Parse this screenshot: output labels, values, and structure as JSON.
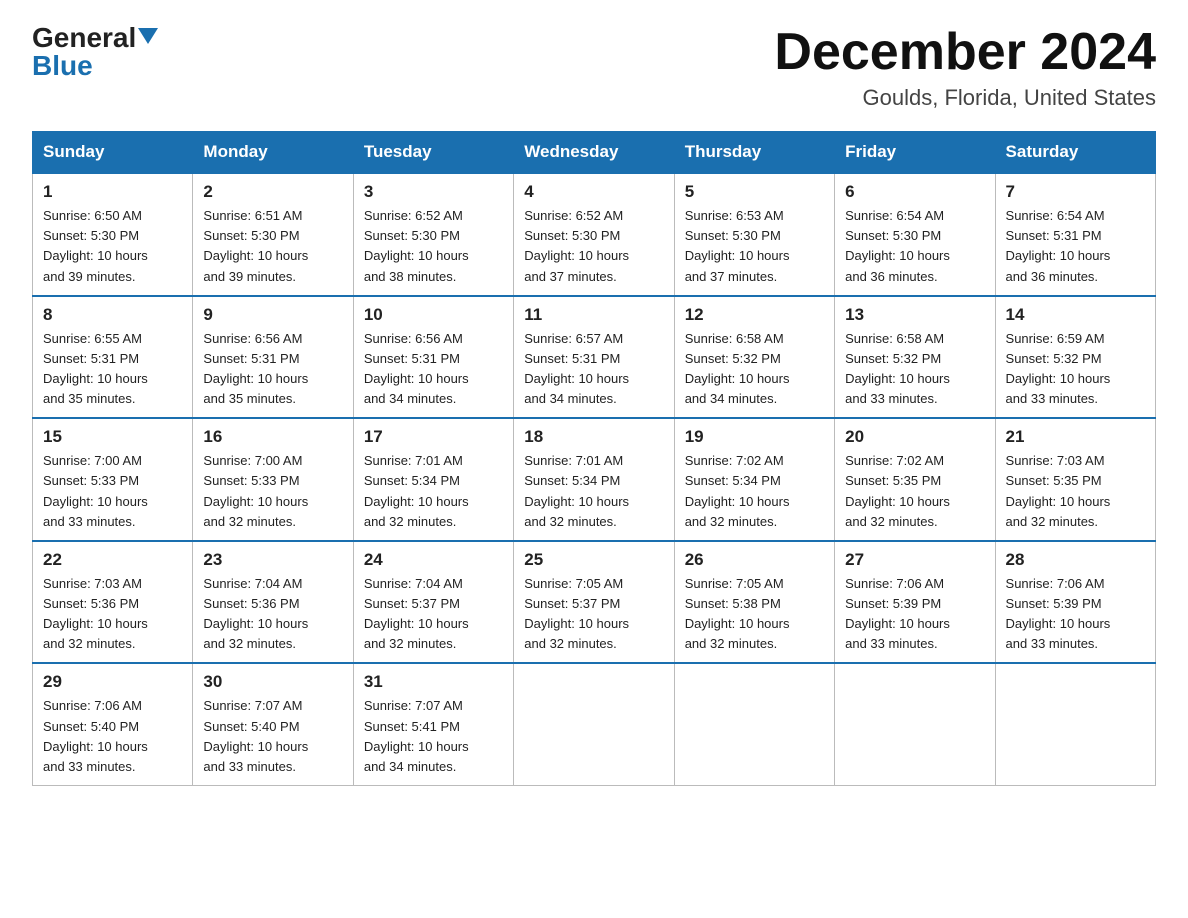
{
  "logo": {
    "general": "General",
    "blue": "Blue"
  },
  "header": {
    "month": "December 2024",
    "location": "Goulds, Florida, United States"
  },
  "weekdays": [
    "Sunday",
    "Monday",
    "Tuesday",
    "Wednesday",
    "Thursday",
    "Friday",
    "Saturday"
  ],
  "weeks": [
    [
      {
        "day": "1",
        "info": "Sunrise: 6:50 AM\nSunset: 5:30 PM\nDaylight: 10 hours\nand 39 minutes."
      },
      {
        "day": "2",
        "info": "Sunrise: 6:51 AM\nSunset: 5:30 PM\nDaylight: 10 hours\nand 39 minutes."
      },
      {
        "day": "3",
        "info": "Sunrise: 6:52 AM\nSunset: 5:30 PM\nDaylight: 10 hours\nand 38 minutes."
      },
      {
        "day": "4",
        "info": "Sunrise: 6:52 AM\nSunset: 5:30 PM\nDaylight: 10 hours\nand 37 minutes."
      },
      {
        "day": "5",
        "info": "Sunrise: 6:53 AM\nSunset: 5:30 PM\nDaylight: 10 hours\nand 37 minutes."
      },
      {
        "day": "6",
        "info": "Sunrise: 6:54 AM\nSunset: 5:30 PM\nDaylight: 10 hours\nand 36 minutes."
      },
      {
        "day": "7",
        "info": "Sunrise: 6:54 AM\nSunset: 5:31 PM\nDaylight: 10 hours\nand 36 minutes."
      }
    ],
    [
      {
        "day": "8",
        "info": "Sunrise: 6:55 AM\nSunset: 5:31 PM\nDaylight: 10 hours\nand 35 minutes."
      },
      {
        "day": "9",
        "info": "Sunrise: 6:56 AM\nSunset: 5:31 PM\nDaylight: 10 hours\nand 35 minutes."
      },
      {
        "day": "10",
        "info": "Sunrise: 6:56 AM\nSunset: 5:31 PM\nDaylight: 10 hours\nand 34 minutes."
      },
      {
        "day": "11",
        "info": "Sunrise: 6:57 AM\nSunset: 5:31 PM\nDaylight: 10 hours\nand 34 minutes."
      },
      {
        "day": "12",
        "info": "Sunrise: 6:58 AM\nSunset: 5:32 PM\nDaylight: 10 hours\nand 34 minutes."
      },
      {
        "day": "13",
        "info": "Sunrise: 6:58 AM\nSunset: 5:32 PM\nDaylight: 10 hours\nand 33 minutes."
      },
      {
        "day": "14",
        "info": "Sunrise: 6:59 AM\nSunset: 5:32 PM\nDaylight: 10 hours\nand 33 minutes."
      }
    ],
    [
      {
        "day": "15",
        "info": "Sunrise: 7:00 AM\nSunset: 5:33 PM\nDaylight: 10 hours\nand 33 minutes."
      },
      {
        "day": "16",
        "info": "Sunrise: 7:00 AM\nSunset: 5:33 PM\nDaylight: 10 hours\nand 32 minutes."
      },
      {
        "day": "17",
        "info": "Sunrise: 7:01 AM\nSunset: 5:34 PM\nDaylight: 10 hours\nand 32 minutes."
      },
      {
        "day": "18",
        "info": "Sunrise: 7:01 AM\nSunset: 5:34 PM\nDaylight: 10 hours\nand 32 minutes."
      },
      {
        "day": "19",
        "info": "Sunrise: 7:02 AM\nSunset: 5:34 PM\nDaylight: 10 hours\nand 32 minutes."
      },
      {
        "day": "20",
        "info": "Sunrise: 7:02 AM\nSunset: 5:35 PM\nDaylight: 10 hours\nand 32 minutes."
      },
      {
        "day": "21",
        "info": "Sunrise: 7:03 AM\nSunset: 5:35 PM\nDaylight: 10 hours\nand 32 minutes."
      }
    ],
    [
      {
        "day": "22",
        "info": "Sunrise: 7:03 AM\nSunset: 5:36 PM\nDaylight: 10 hours\nand 32 minutes."
      },
      {
        "day": "23",
        "info": "Sunrise: 7:04 AM\nSunset: 5:36 PM\nDaylight: 10 hours\nand 32 minutes."
      },
      {
        "day": "24",
        "info": "Sunrise: 7:04 AM\nSunset: 5:37 PM\nDaylight: 10 hours\nand 32 minutes."
      },
      {
        "day": "25",
        "info": "Sunrise: 7:05 AM\nSunset: 5:37 PM\nDaylight: 10 hours\nand 32 minutes."
      },
      {
        "day": "26",
        "info": "Sunrise: 7:05 AM\nSunset: 5:38 PM\nDaylight: 10 hours\nand 32 minutes."
      },
      {
        "day": "27",
        "info": "Sunrise: 7:06 AM\nSunset: 5:39 PM\nDaylight: 10 hours\nand 33 minutes."
      },
      {
        "day": "28",
        "info": "Sunrise: 7:06 AM\nSunset: 5:39 PM\nDaylight: 10 hours\nand 33 minutes."
      }
    ],
    [
      {
        "day": "29",
        "info": "Sunrise: 7:06 AM\nSunset: 5:40 PM\nDaylight: 10 hours\nand 33 minutes."
      },
      {
        "day": "30",
        "info": "Sunrise: 7:07 AM\nSunset: 5:40 PM\nDaylight: 10 hours\nand 33 minutes."
      },
      {
        "day": "31",
        "info": "Sunrise: 7:07 AM\nSunset: 5:41 PM\nDaylight: 10 hours\nand 34 minutes."
      },
      {
        "day": "",
        "info": ""
      },
      {
        "day": "",
        "info": ""
      },
      {
        "day": "",
        "info": ""
      },
      {
        "day": "",
        "info": ""
      }
    ]
  ]
}
